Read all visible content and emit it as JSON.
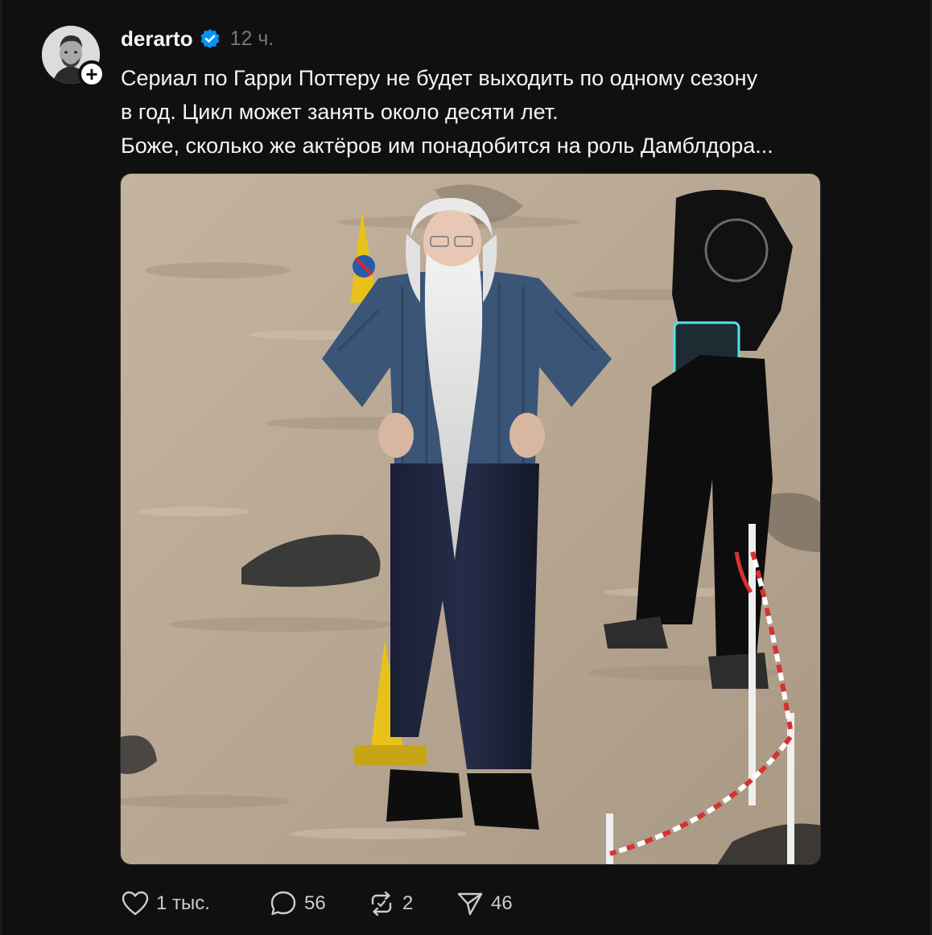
{
  "post": {
    "username": "derarto",
    "verified": true,
    "time": "12 ч.",
    "text_lines": [
      "Сериал по Гарри Поттеру не будет выходить по одному сезону",
      "в год. Цикл может занять около десяти лет.",
      "Боже, сколько же актёров им понадобится на роль Дамблдора..."
    ],
    "follow_symbol": "+"
  },
  "actions": {
    "likes": "1 тыс.",
    "comments": "56",
    "reposts": "2",
    "shares": "46"
  },
  "colors": {
    "background": "#101010",
    "text": "#f3f5f7",
    "secondary": "#777777",
    "verified": "#0095f6"
  },
  "icons": {
    "like": "heart-icon",
    "comment": "comment-bubble-icon",
    "repost": "repost-icon",
    "share": "send-icon",
    "verified": "verified-badge-icon"
  }
}
